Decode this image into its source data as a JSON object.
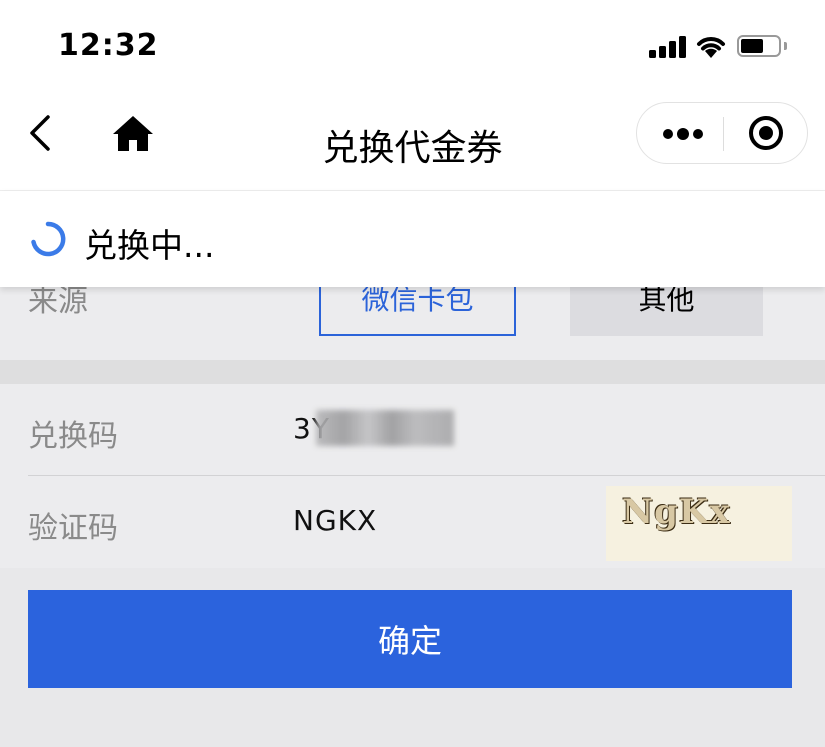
{
  "status_bar": {
    "time": "12:32"
  },
  "nav": {
    "title": "兑换代金券"
  },
  "toast": {
    "text": "兑换中..."
  },
  "source": {
    "label": "来源",
    "options": [
      {
        "label": "微信卡包",
        "selected": true
      },
      {
        "label": "其他",
        "selected": false
      }
    ]
  },
  "form": {
    "code": {
      "label": "兑换码",
      "value": "3Y"
    },
    "verify": {
      "label": "验证码",
      "value": "NGKX",
      "captcha_text": "NgKx"
    }
  },
  "confirm_button": {
    "label": "确定"
  },
  "colors": {
    "accent": "#2b63dd",
    "background": "#ececee",
    "spinner": "#3b7be8"
  },
  "icons": [
    "back-arrow-icon",
    "home-icon",
    "more-dots-icon",
    "close-target-icon",
    "loading-spinner-icon",
    "signal-icon",
    "wifi-icon",
    "battery-icon"
  ]
}
